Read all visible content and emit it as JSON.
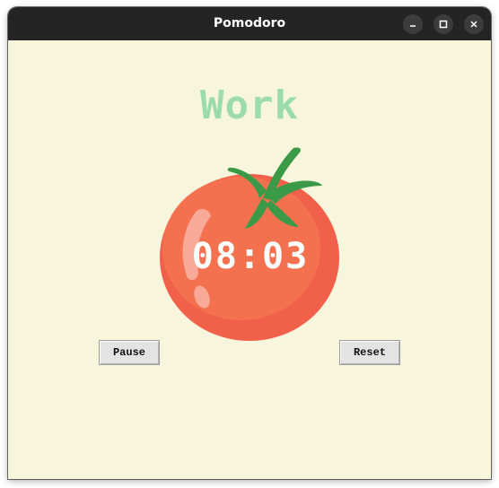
{
  "window": {
    "title": "Pomodoro",
    "controls": [
      "minimize-icon",
      "maximize-icon",
      "close-icon"
    ]
  },
  "main": {
    "mode_label": "Work",
    "timer": "08:03",
    "pause_label": "Pause",
    "reset_label": "Reset"
  },
  "colors": {
    "background": "#f7f5dc",
    "mode_label": "#9bdcaa",
    "tomato": "#f1604a",
    "leaves": "#3a9a47"
  }
}
